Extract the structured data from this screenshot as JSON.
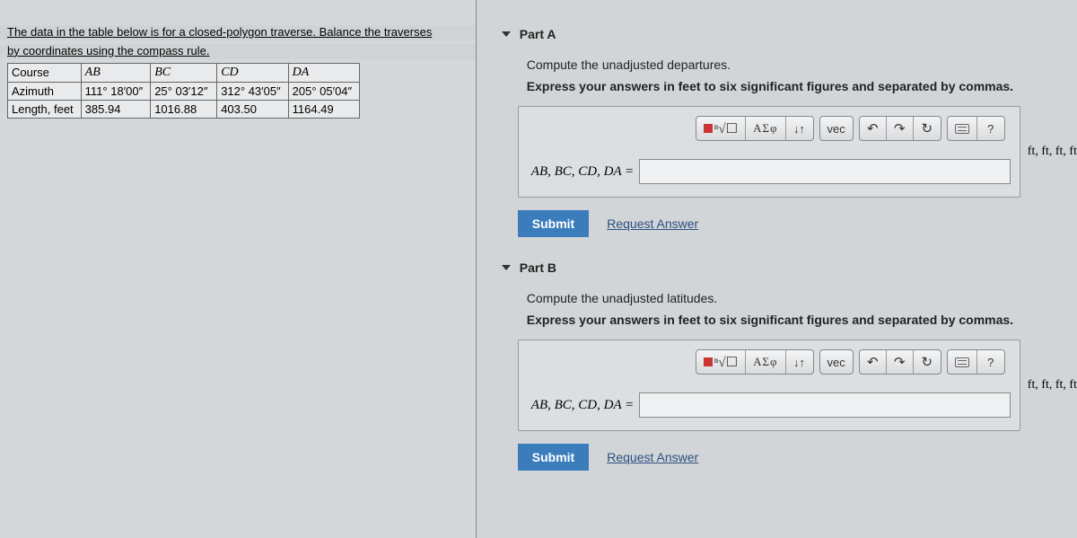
{
  "prompt": {
    "line1": "The data in the table below is for a closed-polygon traverse. Balance the traverses",
    "line2": "by coordinates using the compass rule."
  },
  "table": {
    "headers": [
      "Course",
      "AB",
      "BC",
      "CD",
      "DA"
    ],
    "rows": [
      [
        "Azimuth",
        "111° 18′00″",
        "25° 03′12″",
        "312° 43′05″",
        "205° 05′04″"
      ],
      [
        "Length, feet",
        "385.94",
        "1016.88",
        "403.50",
        "1164.49"
      ]
    ]
  },
  "toolbar": {
    "sqrt": "√x",
    "greek": "ΑΣφ",
    "updown": "↓↑",
    "vec": "vec",
    "undo": "↶",
    "redo": "↷",
    "reset": "↻",
    "help": "?"
  },
  "partA": {
    "title": "Part A",
    "instr1": "Compute the unadjusted departures.",
    "instr2": "Express your answers in feet to six significant figures and separated by commas.",
    "varlabel": "AB, BC, CD, DA =",
    "units": "ft, ft, ft, ft",
    "submit": "Submit",
    "request": "Request Answer"
  },
  "partB": {
    "title": "Part B",
    "instr1": "Compute the unadjusted latitudes.",
    "instr2": "Express your answers in feet to six significant figures and separated by commas.",
    "varlabel": "AB, BC, CD, DA =",
    "units": "ft, ft, ft, ft",
    "submit": "Submit",
    "request": "Request Answer"
  }
}
